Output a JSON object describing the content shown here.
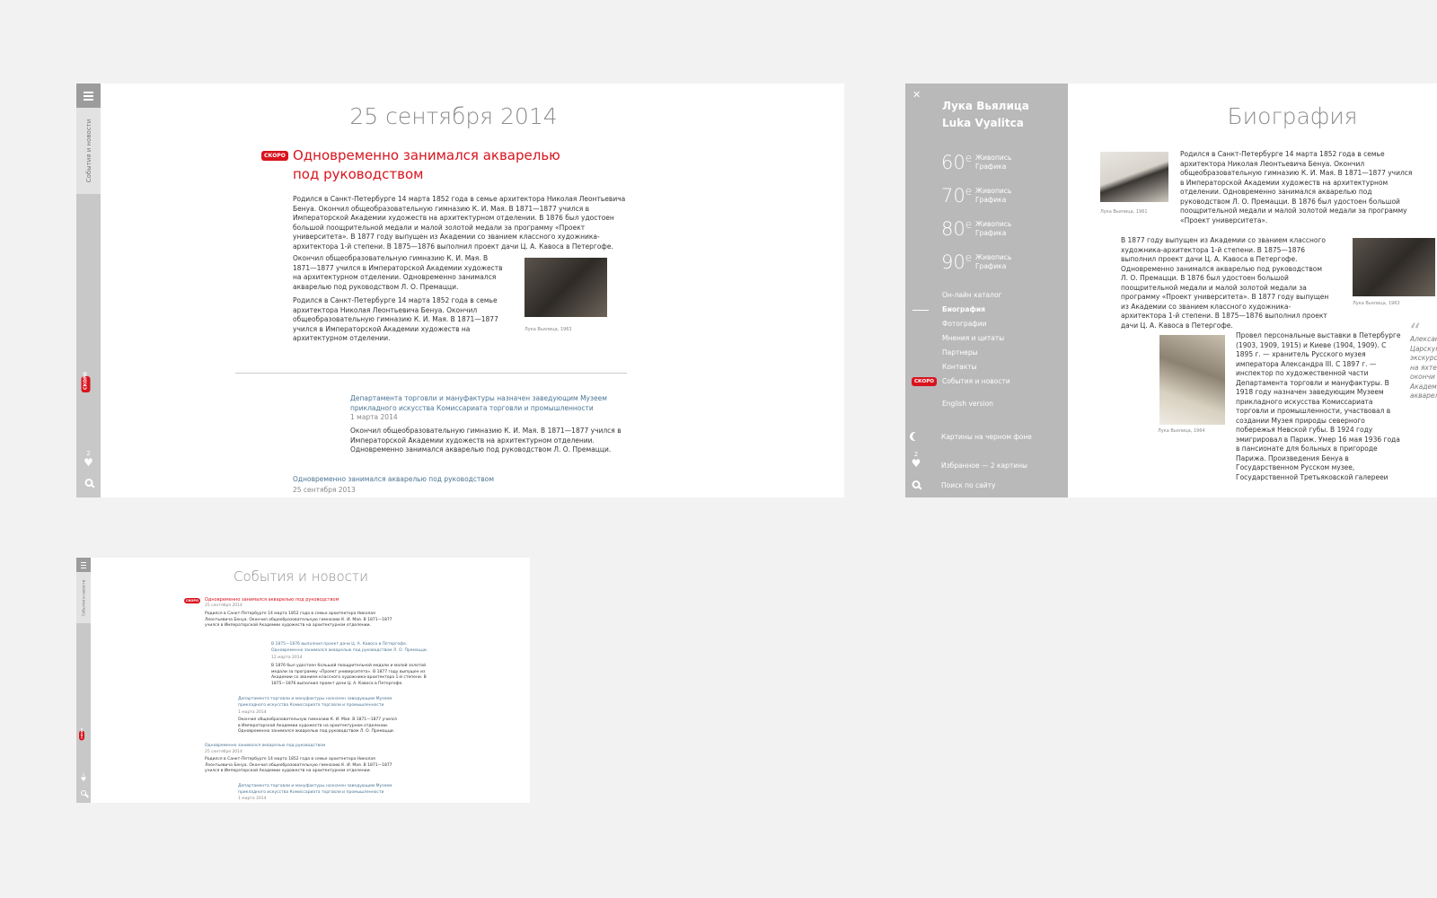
{
  "screen1": {
    "rail_label": "События и новости",
    "soon": "СКОРО",
    "fav_count": "2",
    "title": "25 сентября 2014",
    "lead_title_1": "Одновременно занимался акварелью",
    "lead_title_2": "под руководством",
    "p1": "Родился в Санкт-Петербурге 14 марта 1852 года в семье архитектора Николая Леонтьевича Бенуа. Окончил общеобразовательную гимназию К. И. Мая. В 1871—1877 учился в Императорской Академии художеств на архитектурном отделении. В 1876 был удостоен большой поощрительной медали и малой золотой медали за программу «Проект университета». В 1877 году выпущен из Академии со званием классного художника-архитектора 1-й степени. В 1875—1876 выполнил проект дачи Ц. А. Кавоса в Петергофе.",
    "p2": "Окончил общеобразовательную гимназию К. И. Мая. В 1871—1877 учился в Императорской Академии художеств на архитектурном отделении. Одновременно занимался акварелью под руководством Л. О. Премацци.",
    "p3": "Родился в Санкт-Петербурге 14 марта 1852 года в семье архитектора Николая Леонтьевича Бенуа. Окончил общеобразовательную гимназию К. И. Мая. В 1871—1877 учился в Императорской Академии художеств на архитектурном отделении.",
    "photo_caption": "Лука Вьялица, 1963",
    "news2_title": "Департамента торговли и мануфактуры назначен заведующим Музеем прикладного искусства Комиссариата торговли и промышленности",
    "news2_date": "1 марта 2014",
    "news2_text": "Окончил общеобразовательную гимназию К. И. Мая. В 1871—1877 учился в Императорской Академии художеств на архитектурном отделении. Одновременно занимался акварелью под руководством Л. О. Премацци.",
    "news3_title": "Одновременно занимался акварелью под руководством",
    "news3_date": "25 сентября 2013"
  },
  "screen2": {
    "close": "✕",
    "name_ru": "Лука Вьялица",
    "name_en": "Luka Vyalitca",
    "decades": [
      {
        "num": "60",
        "sup": "е",
        "g1": "Живопись",
        "g2": "Графика"
      },
      {
        "num": "70",
        "sup": "е",
        "g1": "Живопись",
        "g2": "Графика"
      },
      {
        "num": "80",
        "sup": "е",
        "g1": "Живопись",
        "g2": "Графика"
      },
      {
        "num": "90",
        "sup": "е",
        "g1": "Живопись",
        "g2": "Графика"
      }
    ],
    "menu": [
      "Он-лайн каталог",
      "Биография",
      "Фотографии",
      "Мнения и цитаты",
      "Партнеры",
      "Контакты",
      "События и новости"
    ],
    "soon": "СКОРО",
    "english": "English version",
    "dark": "Картины на черном фоне",
    "fav_count": "2",
    "fav": "Избранное — 2 картины",
    "search": "Поиск по сайту",
    "title": "Биография",
    "b1": "Родился в Санкт-Петербурге 14 марта 1852 года в семье архитектора Николая Леонтьевича Бенуа. Окончил общеобразовательную гимназию К. И. Мая. В 1871—1877 учился в Императорской Академии художеств на архитектурном отделении. Одновременно занимался акварелью под руководством Л. О. Премацци. В 1876 был удостоен большой поощрительной медали и малой золотой медали за программу «Проект университета».",
    "cap1": "Лука Вьялица, 1961",
    "b2": "В 1877 году выпущен из Академии со званием классного художника-архитектора 1-й степени. В 1875—1876 выполнил проект дачи Ц. А. Кавоса в Петергофе. Одновременно занимался акварелью под руководством Л. О. Премацци. В 1876 был удостоен большой поощрительной медали и малой золотой медали за программу «Проект университета». В 1877 году выпущен из Академии со званием классного художника-архитектора 1-й степени. В 1875—1876 выполнил проект дачи Ц. А. Кавоса в Петергофе.",
    "cap2": "Лука Вьялица, 1963",
    "b3": "Провел персональные выставки в Петербурге (1903, 1909, 1915) и Киеве (1904, 1909). С 1895 г. — хранитель Русского музея императора Александра III. С 1897 г. — инспектор по художественной части Департамента торговли и мануфактуры. В 1918 году назначен заведующим Музеем прикладного искусства Комиссариата торговли и промышленности, участвовал в создании Музея природы северного побережья Невской губы. В 1924 году эмигрировал в Париж. Умер 16 мая 1936 года в пансионате для больных в пригороде Парижа. Произведения Бенуа в Государственном Русском музее, Государственной Третьяковской галерееи",
    "cap3": "Лука Вьялица, 1964",
    "quote": "Александр Царскую экскурс на яхте окончи Академ акварел"
  },
  "screen3": {
    "rail_label": "События и новости",
    "soon": "СКОРО",
    "fav_count": "2",
    "title": "События и новости",
    "n1_title": "Одновременно занимался акварелью под руководством",
    "n1_date": "25 сентября 2014",
    "n1_text": "Родился в Санкт-Петербурге 14 марта 1852 года в семье архитектора Николая Леонтьевича Бенуа. Окончил общеобразовательную гимназию К. И. Мая. В 1871—1877 учился в Императорской Академии художеств на архитектурном отделении.",
    "n2_title": "В 1875—1876 выполнил проект дачи Ц. А. Кавоса в Петергофе. Одновременно занимался акварелью под руководством Л. О. Премацци.",
    "n2_date": "12 марта 2014",
    "n2_text": "В 1876 был удостоен большой поощрительной медали и малой золотой медали за программу «Проект университета». В 1877 году выпущен из Академии со званием классного художника-архитектора 1-й степени. В 1875—1876 выполнил проект дачи Ц. А. Кавоса в Петергофе.",
    "n3_title": "Департамента торговли и мануфактуры назначен заведующим Музеем прикладного искусства Комиссариата торговли и промышленности",
    "n3_date": "1 марта 2014",
    "n3_text": "Окончил общеобразовательную гимназию К. И. Мая. В 1871—1877 учился в Императорской Академии художеств на архитектурном отделении. Одновременно занимался акварелью под руководством Л. О. Премацци.",
    "n4_title": "Одновременно занимался акварелью под руководством",
    "n4_date": "25 сентября 2014",
    "n4_text": "Родился в Санкт-Петербурге 14 марта 1852 года в семье архитектора Николая Леонтьевича Бенуа. Окончил общеобразовательную гимназию К. И. Мая. В 1871—1877 учился в Императорской Академии художеств на архитектурном отделении.",
    "n5_title": "Департамента торговли и мануфактуры назначен заведующим Музеем прикладного искусства Комиссариата торговли и промышленности",
    "n5_date": "1 марта 2014"
  }
}
